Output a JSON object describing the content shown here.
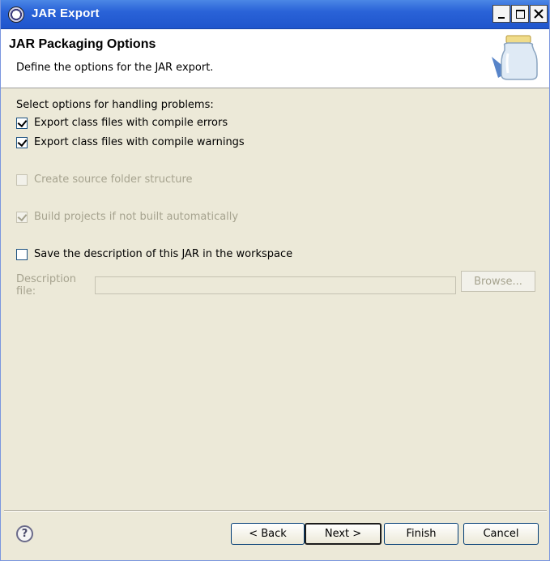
{
  "window": {
    "title": "JAR Export"
  },
  "banner": {
    "title": "JAR Packaging Options",
    "description": "Define the options for the JAR export."
  },
  "options": {
    "section_label": "Select options for handling problems:",
    "export_errors": {
      "label": "Export class files with compile errors",
      "checked": true,
      "enabled": true
    },
    "export_warnings": {
      "label": "Export class files with compile warnings",
      "checked": true,
      "enabled": true
    },
    "create_source_folder": {
      "label": "Create source folder structure",
      "checked": false,
      "enabled": false
    },
    "build_projects": {
      "label": "Build projects if not built automatically",
      "checked": true,
      "enabled": false
    },
    "save_description": {
      "label": "Save the description of this JAR in the workspace",
      "checked": false,
      "enabled": true
    }
  },
  "description_file": {
    "label": "Description file:",
    "value": "",
    "browse_label": "Browse..."
  },
  "footer": {
    "help_glyph": "?",
    "back_label": "< Back",
    "next_label": "Next >",
    "finish_label": "Finish",
    "cancel_label": "Cancel"
  },
  "colors": {
    "titlebar": "#2a63d8",
    "dialog_bg": "#ece9d8",
    "disabled_text": "#a6a38f"
  }
}
